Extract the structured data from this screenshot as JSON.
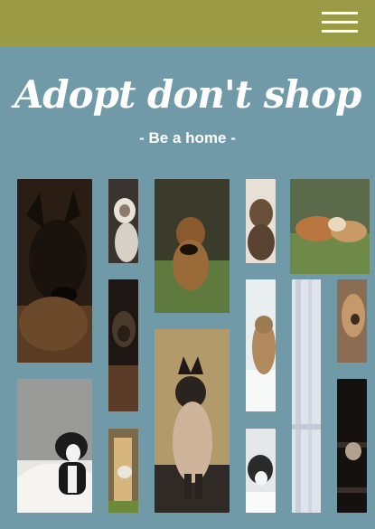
{
  "header": {
    "menu_icon": "hamburger-menu-icon"
  },
  "hero": {
    "title": "Adopt don't shop",
    "subtitle": "- Be a home -"
  },
  "gallery": {
    "photos": [
      "german-shepherd-photo",
      "ragdoll-cat-photo",
      "airedale-terrier-photo",
      "puppy-portrait-photo",
      "dog-cat-lying-photo",
      "dark-dog-photo",
      "tabby-cat-on-bed-photo",
      "long-hair-dog-photo",
      "siamese-cat-photo",
      "boston-terrier-on-bed-photo",
      "window-curtain-photo",
      "cat-tower-photo",
      "tuxedo-cat-photo",
      "cat-on-dark-shelf-photo"
    ]
  }
}
